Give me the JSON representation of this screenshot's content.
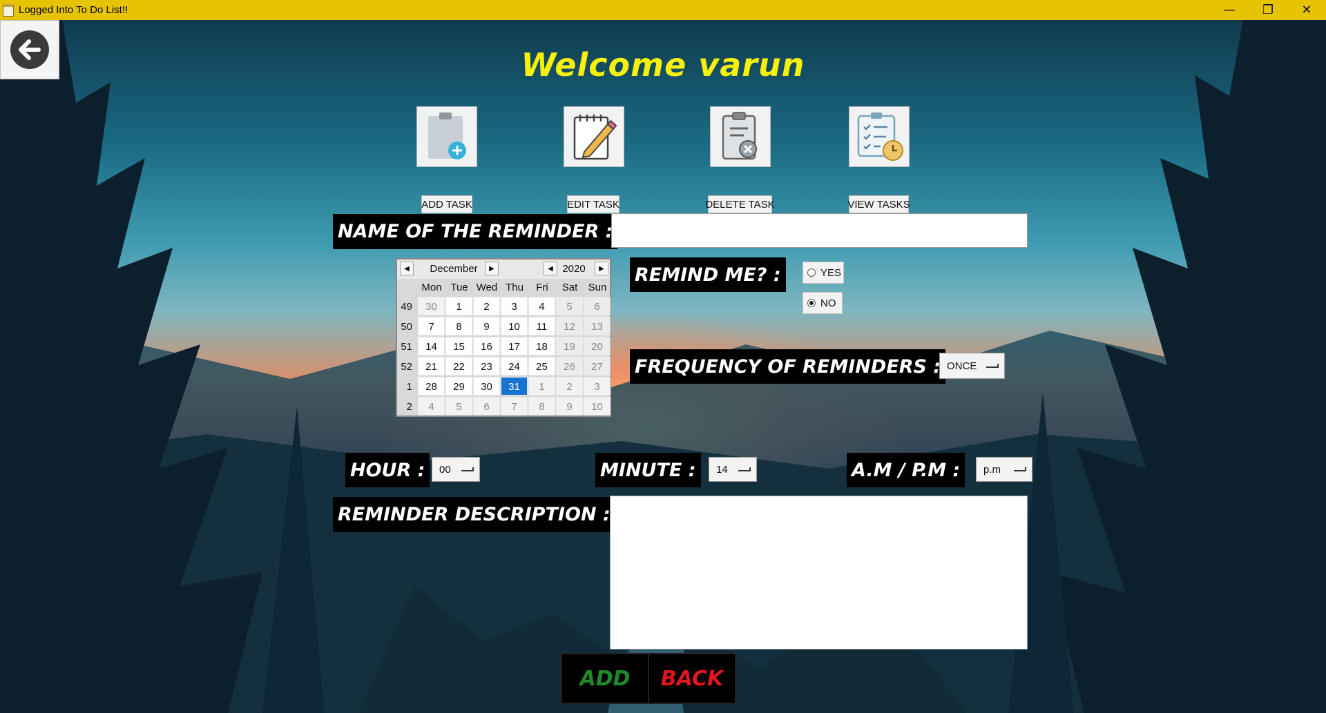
{
  "window": {
    "title": "Logged Into To Do List!!",
    "minimize_glyph": "—",
    "maximize_glyph": "❐",
    "close_glyph": "✕"
  },
  "welcome": "Welcome varun",
  "toolbar": {
    "add_task": "ADD TASK",
    "edit_task": "EDIT TASK",
    "delete_task": "DELETE TASK",
    "view_tasks": "VIEW TASKS"
  },
  "form": {
    "name_label": "NAME OF THE REMINDER :",
    "name_value": "",
    "remind_label": "REMIND ME? :",
    "remind_yes": "YES",
    "remind_no": "NO",
    "remind_selected": "NO",
    "frequency_label": "FREQUENCY OF REMINDERS :",
    "frequency_value": "ONCE",
    "hour_label": "HOUR :",
    "hour_value": "00",
    "minute_label": "MINUTE :",
    "minute_value": "14",
    "ampm_label": "A.M / P.M :",
    "ampm_value": "p.m",
    "description_label": "REMINDER DESCRIPTION :",
    "description_value": ""
  },
  "calendar": {
    "month": "December",
    "year": "2020",
    "weekdays": [
      "Mon",
      "Tue",
      "Wed",
      "Thu",
      "Fri",
      "Sat",
      "Sun"
    ],
    "weeks": [
      {
        "week": "49",
        "days": [
          "30",
          "1",
          "2",
          "3",
          "4",
          "5",
          "6"
        ]
      },
      {
        "week": "50",
        "days": [
          "7",
          "8",
          "9",
          "10",
          "11",
          "12",
          "13"
        ]
      },
      {
        "week": "51",
        "days": [
          "14",
          "15",
          "16",
          "17",
          "18",
          "19",
          "20"
        ]
      },
      {
        "week": "52",
        "days": [
          "21",
          "22",
          "23",
          "24",
          "25",
          "26",
          "27"
        ]
      },
      {
        "week": "1",
        "days": [
          "28",
          "29",
          "30",
          "31",
          "1",
          "2",
          "3"
        ]
      },
      {
        "week": "2",
        "days": [
          "4",
          "5",
          "6",
          "7",
          "8",
          "9",
          "10"
        ]
      }
    ],
    "selected_day": "31"
  },
  "buttons": {
    "add": "ADD",
    "back": "BACK"
  },
  "colors": {
    "titlebar": "#e6c402",
    "welcome_text": "#f7f10a",
    "add_text": "#1f8a2c",
    "back_text": "#e3161c",
    "calendar_selected": "#1874d2"
  }
}
